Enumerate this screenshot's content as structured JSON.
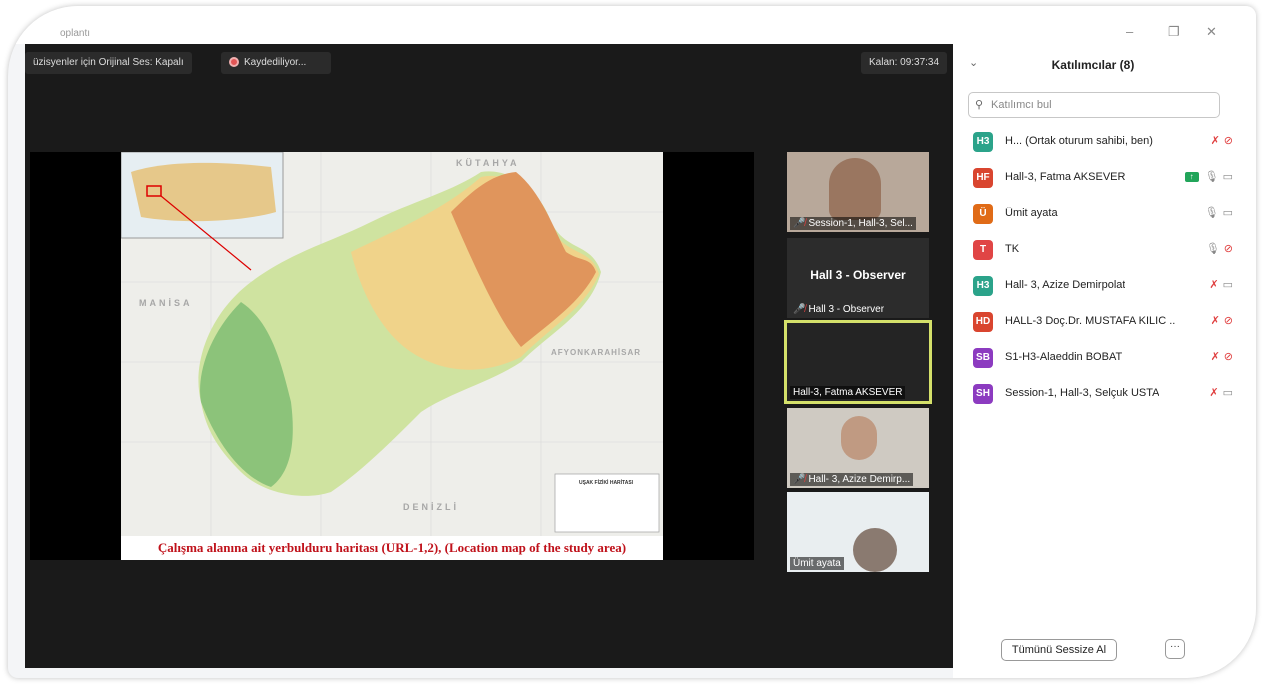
{
  "window": {
    "title": "oplantı",
    "minimize": "–",
    "restore": "❐",
    "close": "✕"
  },
  "toolbar": {
    "audio_label": "üzisyenler için Orijinal Ses: Kapalı",
    "recording_label": "Kaydediliyor...",
    "remaining_label": "Kalan: 09:37:34"
  },
  "shared": {
    "caption": "Çalışma alanına ait yerbulduru haritası (URL-1,2), (Location map of the study area)",
    "labels": {
      "kutahya": "KÜTAHYA",
      "manisa": "MANİSA",
      "afyon": "AFYONKARAHİSAR",
      "denizli": "DENİZLİ"
    },
    "legend_title": "UŞAK FİZİKİ HARİTASI"
  },
  "tiles": [
    {
      "name": "Session-1, Hall-3, Sel...",
      "muted": true
    },
    {
      "name": "Hall 3 - Observer",
      "center": "Hall 3 - Observer",
      "muted": true
    },
    {
      "name": "Hall-3, Fatma AKSEVER",
      "muted": false
    },
    {
      "name": "Hall- 3, Azize Demirp...",
      "muted": true
    },
    {
      "name": "Ümit ayata",
      "muted": false
    }
  ],
  "panel": {
    "title": "Katılımcılar (8)",
    "search_placeholder": "Katılımcı bul",
    "participants": [
      {
        "initials": "H3",
        "name": "H... (Ortak oturum sahibi, ben)",
        "color": "#2ba38a",
        "mic": "off",
        "cam": "off"
      },
      {
        "initials": "HF",
        "name": "Hall-3, Fatma AKSEVER",
        "color": "#d9452f",
        "mic": "on",
        "cam": "on",
        "sharing": true
      },
      {
        "initials": "Ü",
        "name": "Ümit ayata",
        "color": "#e06b17",
        "mic": "on",
        "cam": "on"
      },
      {
        "initials": "T",
        "name": "TK",
        "color": "#e04545",
        "mic": "on",
        "cam": "off"
      },
      {
        "initials": "H3",
        "name": "Hall- 3, Azize Demirpolat",
        "color": "#2ba38a",
        "mic": "off",
        "cam": "on"
      },
      {
        "initials": "HD",
        "name": "HALL-3 Doç.Dr. MUSTAFA KILIC ...",
        "color": "#d9452f",
        "mic": "off",
        "cam": "off"
      },
      {
        "initials": "SB",
        "name": "S1-H3-Alaeddin BOBAT",
        "color": "#8c3bc0",
        "mic": "off",
        "cam": "off"
      },
      {
        "initials": "SH",
        "name": "Session-1, Hall-3, Selçuk USTA",
        "color": "#8c3bc0",
        "mic": "off",
        "cam": "on"
      }
    ],
    "mute_all": "Tümünü Sessize Al",
    "more": "···"
  }
}
